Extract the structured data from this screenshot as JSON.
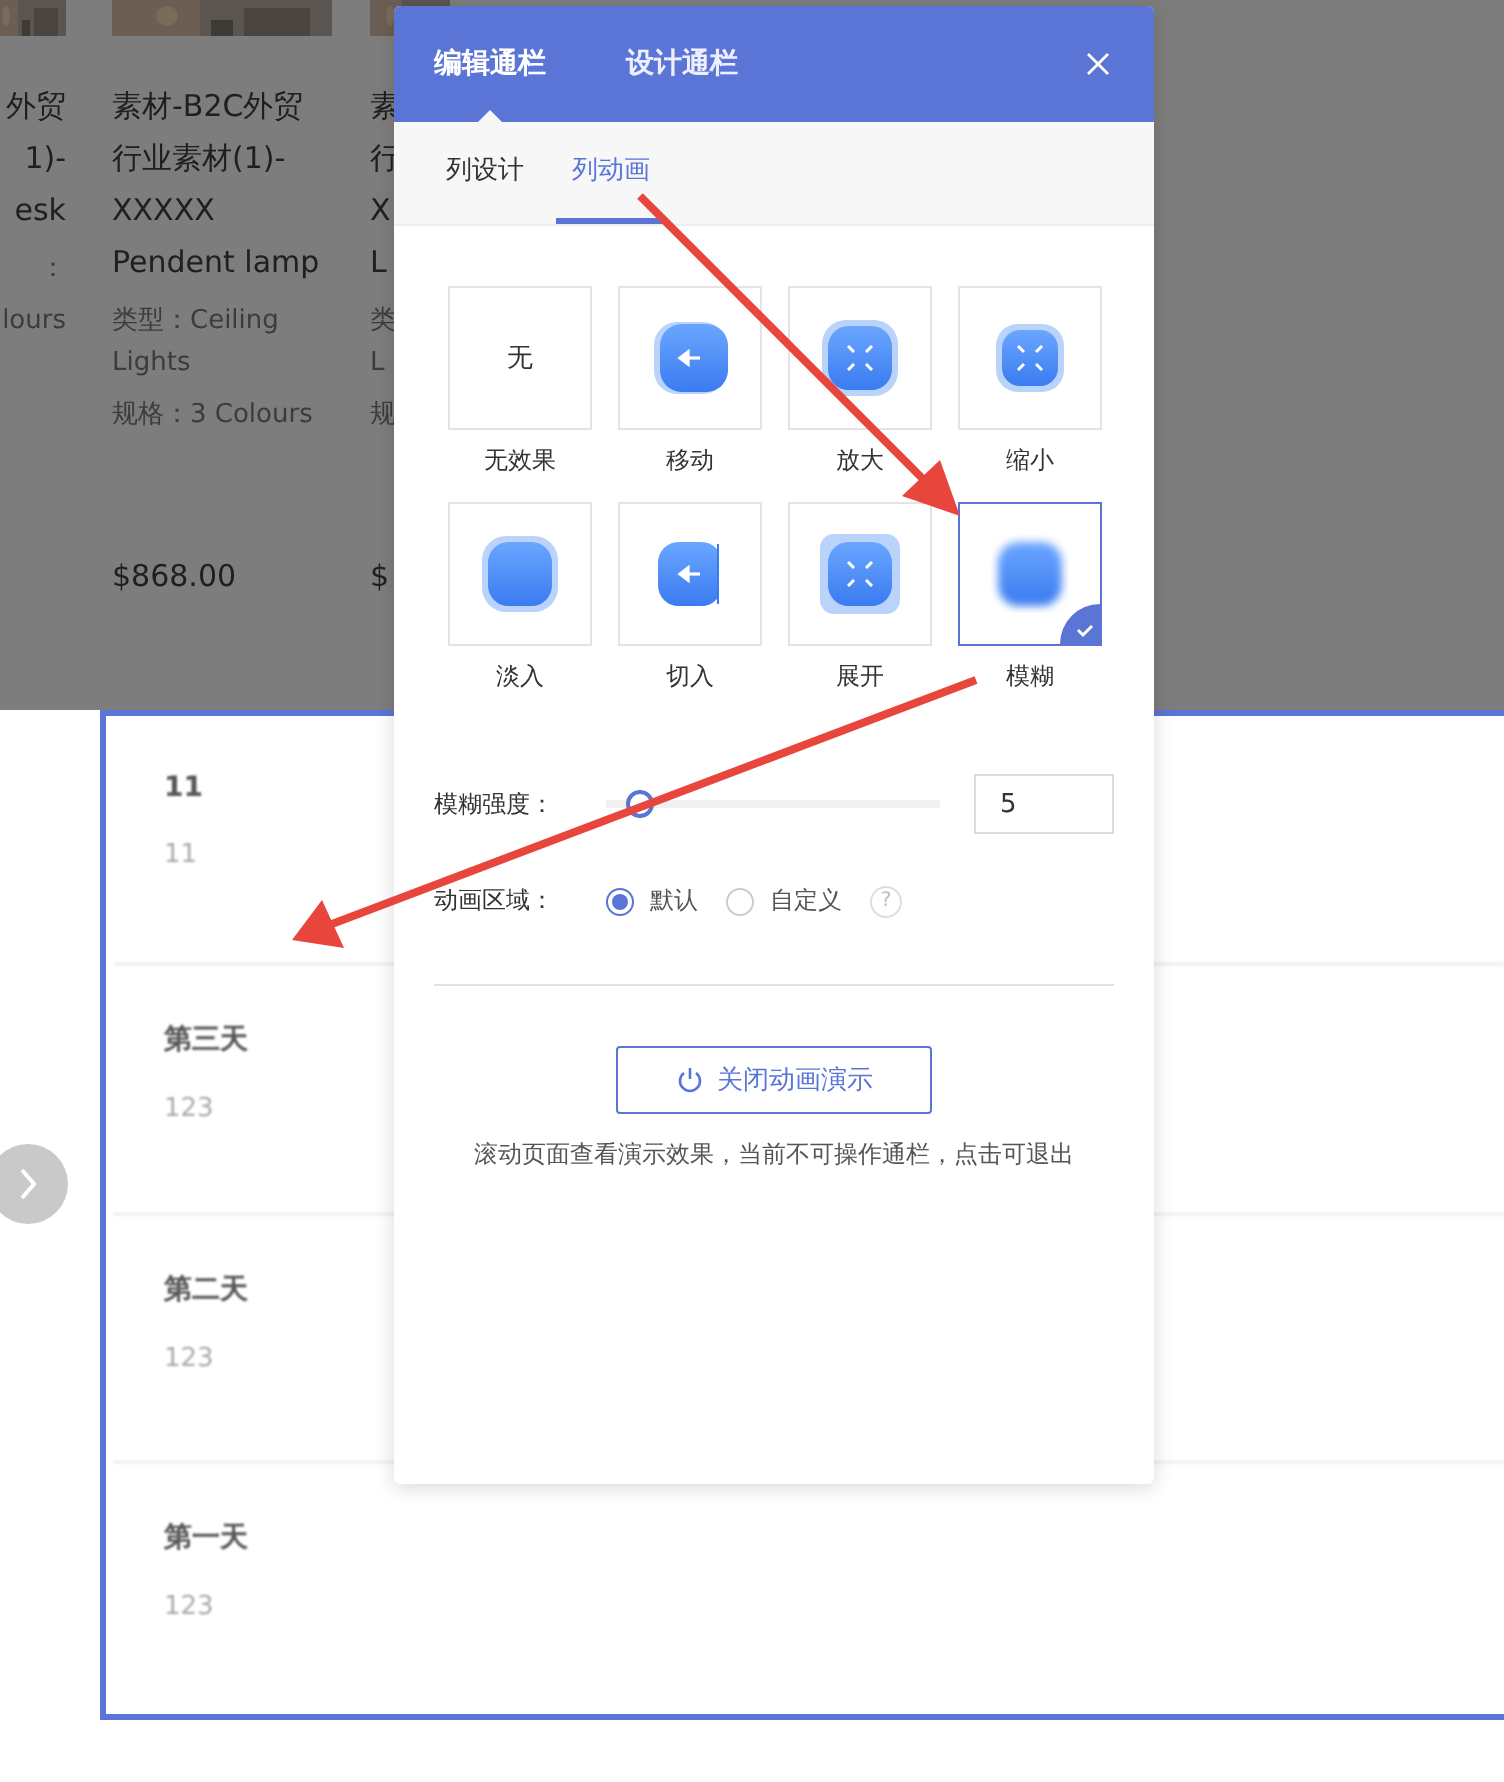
{
  "product_cards": [
    {
      "title_lines": [
        "外贸",
        "1)-",
        "esk"
      ],
      "type_lines": [
        "："
      ],
      "spec": "lours"
    },
    {
      "title_lines": [
        "素材-B2C外贸",
        "行业素材(1)-",
        "XXXXX",
        "Pendent lamp"
      ],
      "type_lines": [
        "类型：Ceiling",
        "Lights"
      ],
      "spec": "规格：3 Colours",
      "price": "$868.00"
    },
    {
      "title_lines": [
        "素",
        "行",
        "X",
        "L"
      ],
      "type_lines": [
        "类",
        "L"
      ],
      "spec": "规",
      "price": "$"
    }
  ],
  "timeline": [
    {
      "title": "11",
      "subtitle": "11"
    },
    {
      "title": "第三天",
      "subtitle": "123"
    },
    {
      "title": "第二天",
      "subtitle": "123"
    },
    {
      "title": "第一天",
      "subtitle": "123"
    }
  ],
  "dialog": {
    "tabs": [
      {
        "label": "编辑通栏",
        "selected": true
      },
      {
        "label": "设计通栏",
        "selected": false
      }
    ],
    "subtabs": [
      {
        "label": "列设计",
        "selected": false
      },
      {
        "label": "列动画",
        "selected": true
      }
    ],
    "effects": [
      {
        "kind": "none",
        "glyph": "无",
        "label": "无效果",
        "selected": false
      },
      {
        "kind": "move",
        "label": "移动",
        "selected": false
      },
      {
        "kind": "zoom_in",
        "label": "放大",
        "selected": false
      },
      {
        "kind": "zoom_out",
        "label": "缩小",
        "selected": false
      },
      {
        "kind": "fade",
        "label": "淡入",
        "selected": false
      },
      {
        "kind": "cut",
        "label": "切入",
        "selected": false
      },
      {
        "kind": "expand",
        "label": "展开",
        "selected": false
      },
      {
        "kind": "blur",
        "label": "模糊",
        "selected": true
      }
    ],
    "strength": {
      "label": "模糊强度：",
      "level": 0.1,
      "value": "5"
    },
    "area": {
      "label": "动画区域：",
      "options": [
        {
          "label": "默认",
          "selected": true
        },
        {
          "label": "自定义",
          "selected": false
        }
      ],
      "help": "?"
    },
    "demo_button": "关闭动画演示",
    "note": "滚动页面查看演示效果，当前不可操作通栏，点击可退出"
  }
}
